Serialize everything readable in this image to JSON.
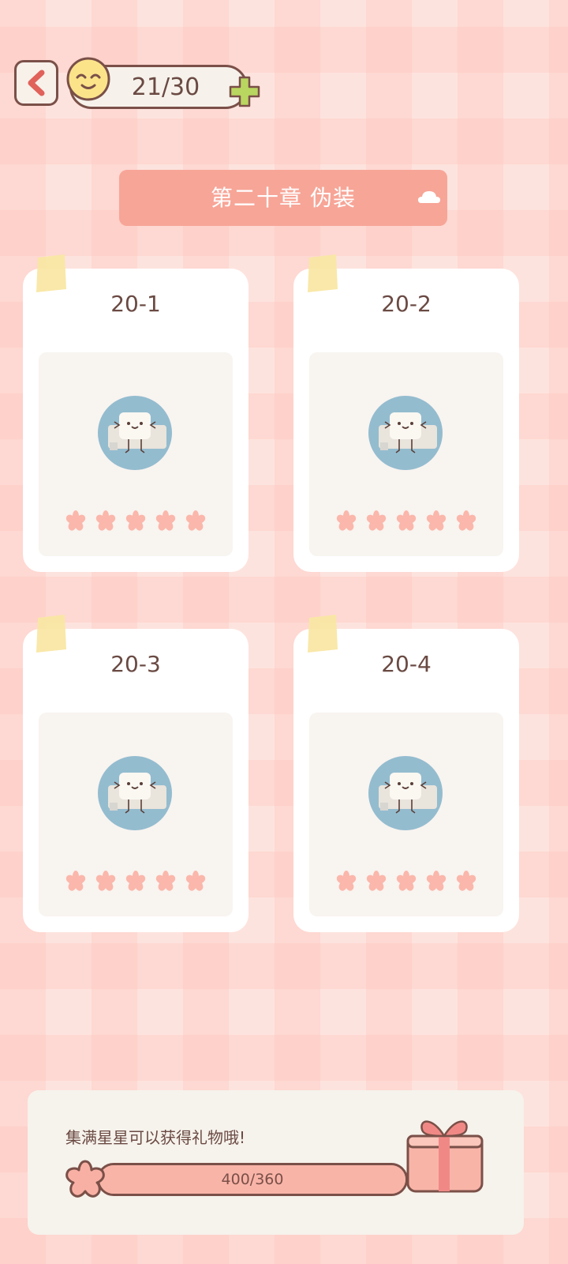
{
  "header": {
    "energy": "21/30",
    "icons": {
      "back": "back-arrow-icon",
      "energy": "smiley-coin-icon",
      "plus": "plus-icon"
    }
  },
  "chapter": {
    "title": "第二十章  伪装",
    "toggle_icon": "cloud-up-icon"
  },
  "levels": [
    {
      "label": "20-1",
      "stars_earned": 5
    },
    {
      "label": "20-2",
      "stars_earned": 5
    },
    {
      "label": "20-3",
      "stars_earned": 5
    },
    {
      "label": "20-4",
      "stars_earned": 5
    }
  ],
  "reward": {
    "message": "集满星星可以获得礼物哦!",
    "progress_text": "400/360",
    "progress_fraction": 1.0,
    "icons": {
      "star": "star-badge-icon",
      "gift": "gift-box-icon"
    }
  },
  "colors": {
    "accent": "#f7a597",
    "star": "#fbb7ab",
    "text": "#6a4a43",
    "outline": "#7a5048",
    "character_bg": "#94bccf"
  }
}
